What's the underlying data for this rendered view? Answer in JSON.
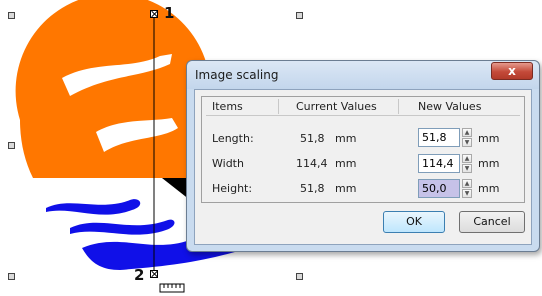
{
  "canvas": {
    "node_labels": [
      "1",
      "2"
    ],
    "colors": {
      "sun": "#ff7700",
      "waves": "#1010e8",
      "boat": "#000000"
    }
  },
  "dialog": {
    "title": "Image scaling",
    "close_glyph": "x",
    "columns": [
      "Items",
      "Current Values",
      "New Values"
    ],
    "rows": [
      {
        "label": "Length:",
        "current": "51,8",
        "current_unit": "mm",
        "new": "51,8",
        "new_unit": "mm"
      },
      {
        "label": "Width",
        "current": "114,4",
        "current_unit": "mm",
        "new": "114,4",
        "new_unit": "mm"
      },
      {
        "label": "Height:",
        "current": "51,8",
        "current_unit": "mm",
        "new": "50,0",
        "new_unit": "mm"
      }
    ],
    "ok_label": "OK",
    "cancel_label": "Cancel"
  }
}
